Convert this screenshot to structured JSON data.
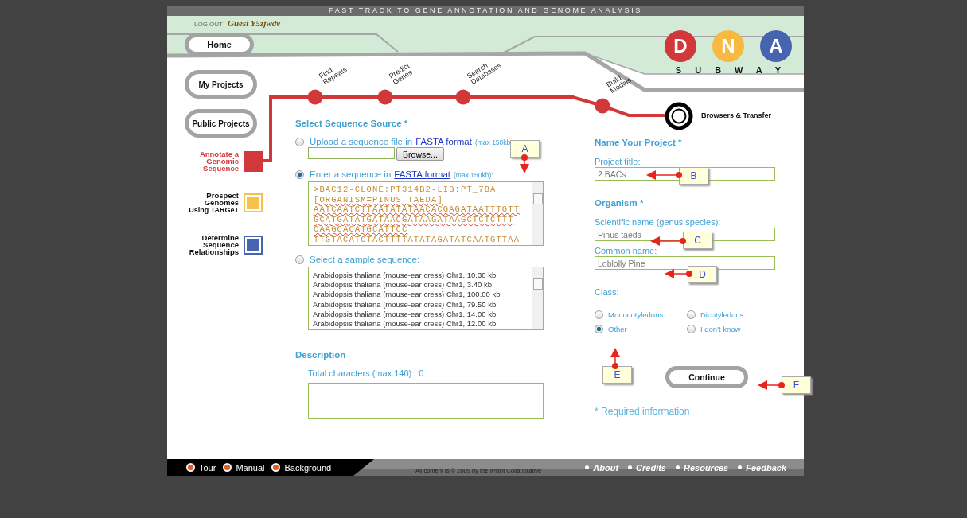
{
  "tagline": "FAST TRACK TO GENE ANNOTATION AND GENOME ANALYSIS",
  "user": {
    "logout": "LOG OUT",
    "name": "Guest Y5zjwdv"
  },
  "logo": {
    "letters": [
      {
        "letter": "D",
        "color": "#d2383a"
      },
      {
        "letter": "N",
        "color": "#f7b940"
      },
      {
        "letter": "A",
        "color": "#4664b0"
      }
    ],
    "wordmark": "SUBWAY"
  },
  "nav": [
    {
      "label": "Home"
    },
    {
      "label": "My Projects"
    },
    {
      "label": "Public Projects"
    }
  ],
  "workflows": [
    {
      "label": "Annotate a Genomic Sequence",
      "selected": true,
      "color": "#d2383a"
    },
    {
      "label": "Prospect Genomes",
      "sublabel": "Using TARGeT",
      "selected": false,
      "color": "#f7c24a"
    },
    {
      "label": "Determine Sequence Relationships",
      "selected": false,
      "color": "#4664b0"
    }
  ],
  "stops": [
    {
      "label": "Find Repeats"
    },
    {
      "label": "Predict Genes"
    },
    {
      "label": "Search Databases"
    },
    {
      "label": "Build Models"
    },
    {
      "label": "Browsers & Transfer",
      "kind": "terminal"
    }
  ],
  "source": {
    "heading": "Select Sequence Source *",
    "options": [
      {
        "kind": "upload",
        "text": "Upload a sequence file in",
        "link": "FASTA format",
        "note": "(max 150kb",
        "selected": false,
        "button": "Browse..."
      },
      {
        "kind": "paste",
        "text": "Enter a sequence in",
        "link": "FASTA format",
        "note": "(max 150kb):",
        "selected": true,
        "lines": [
          {
            "text": ">BAC12-CLONE:PT314B2-LIB:PT_7BA",
            "misspelled": false
          },
          {
            "text": "[ORGANISM=PINUS TAEDA]",
            "misspelled": true
          },
          {
            "text": "AATCAATCTTAATATATAACACGAGATAATTTGTT",
            "misspelled": true
          },
          {
            "text": "GCATGATATGATAACGATAAGATAAGCTCTCTTT",
            "misspelled": true
          },
          {
            "text": "CAAGCACATGCATTCC",
            "misspelled": true
          },
          {
            "text": "TTGTACATCTACTTTTATATAGATATCAATGTTAA",
            "misspelled": false
          }
        ]
      },
      {
        "kind": "sample",
        "text": "Select a sample sequence:",
        "selected": false,
        "samples": [
          "Arabidopsis thaliana (mouse-ear cress) Chr1, 10.30 kb",
          "Arabidopsis thaliana (mouse-ear cress) Chr1, 3.40 kb",
          "Arabidopsis thaliana (mouse-ear cress) Chr1, 100.00 kb",
          "Arabidopsis thaliana (mouse-ear cress) Chr1, 79.50 kb",
          "Arabidopsis thaliana (mouse-ear cress) Chr1, 14.00 kb",
          "Arabidopsis thaliana (mouse-ear cress) Chr1, 12.00 kb"
        ]
      }
    ]
  },
  "description": {
    "heading": "Description",
    "counter_label": "Total characters (max.140):",
    "counter": "0"
  },
  "project": {
    "heading": "Name Your Project *",
    "title_label": "Project title:",
    "title_value": "2 BACs"
  },
  "organism": {
    "heading": "Organism *",
    "scientific_label": "Scientific name (genus species):",
    "scientific_value": "Pinus taeda",
    "common_label": "Common name:",
    "common_value": "Loblolly Pine",
    "class_label": "Class:",
    "classes": [
      {
        "label": "Monocotyledons",
        "selected": false
      },
      {
        "label": "Dicotyledons",
        "selected": false
      },
      {
        "label": "Other",
        "selected": true
      },
      {
        "label": "I don't know",
        "selected": false
      }
    ]
  },
  "continue_button": "Continue",
  "required_note": "* Required information",
  "callouts": [
    {
      "label": "A"
    },
    {
      "label": "B"
    },
    {
      "label": "C"
    },
    {
      "label": "D"
    },
    {
      "label": "E"
    },
    {
      "label": "F"
    }
  ],
  "footer": {
    "links_left": [
      "Tour",
      "Manual",
      "Background"
    ],
    "copyright": "All content is © 2009 by the iPlant Collaborative",
    "links_right": [
      "About",
      "Credits",
      "Resources",
      "Feedback"
    ]
  }
}
